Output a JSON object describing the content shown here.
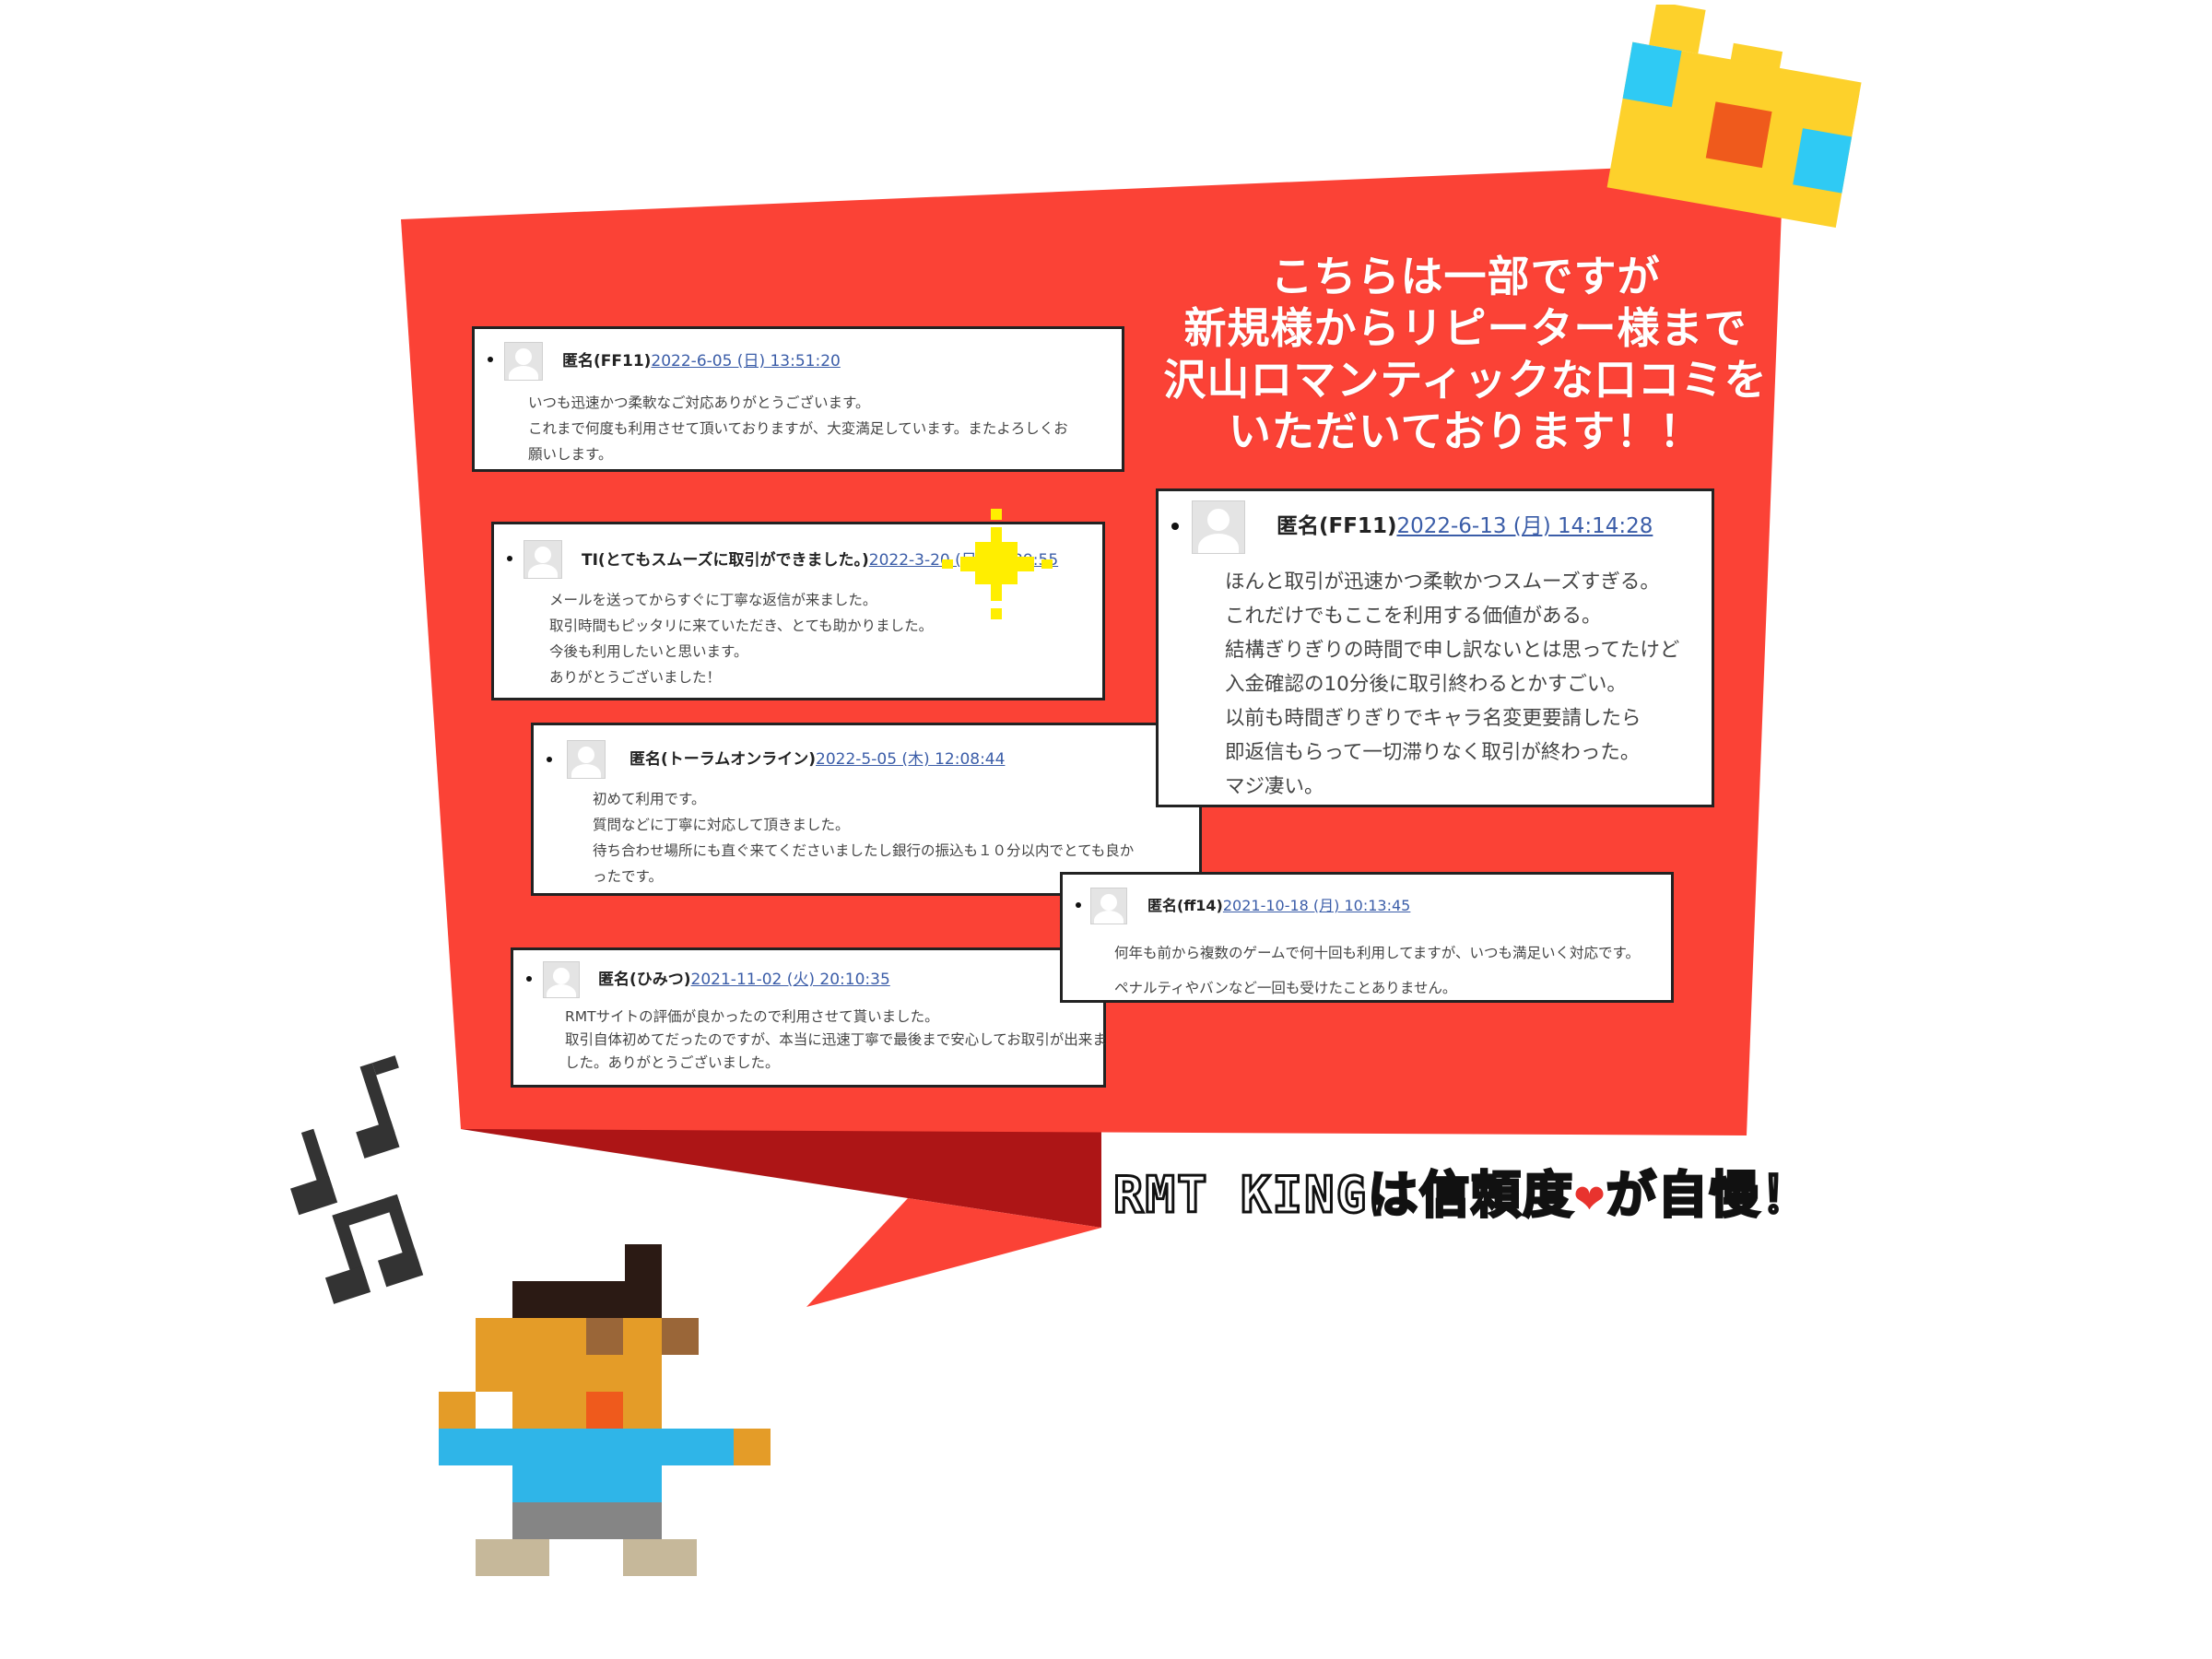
{
  "headline": {
    "lines": [
      "こちらは一部ですが",
      "新規様からリピーター様まで",
      "沢山ロマンティックな口コミを",
      "いただいております！！"
    ]
  },
  "reviews": [
    {
      "author": "匿名(FF11)",
      "date": "2022-6-05 (日) 13:51:20",
      "lines": [
        "いつも迅速かつ柔軟なご対応ありがとうございます。",
        "これまで何度も利用させて頂いておりますが、大変満足しています。またよろしくお",
        "願いします。"
      ]
    },
    {
      "author": "TI(とてもスムーズに取引ができました。)",
      "date": "2022-3-20 (日) 15:39:55",
      "lines": [
        "メールを送ってからすぐに丁寧な返信が来ました。",
        "取引時間もピッタリに来ていただき、とても助かりました。",
        "今後も利用したいと思います。",
        "ありがとうございました！"
      ]
    },
    {
      "author": "匿名(トーラムオンライン)",
      "date": "2022-5-05 (木) 12:08:44",
      "lines": [
        "初めて利用です。",
        "質問などに丁寧に対応して頂きました。",
        "待ち合わせ場所にも直ぐ来てくださいましたし銀行の振込も１０分以内でとても良か",
        "ったです。"
      ]
    },
    {
      "author": "匿名(ひみつ)",
      "date": "2021-11-02 (火) 20:10:35",
      "lines": [
        "RMTサイトの評価が良かったので利用させて貰いました。",
        "取引自体初めてだったのですが、本当に迅速丁寧で最後まで安心してお取引が出来ま",
        "した。ありがとうございました。"
      ]
    },
    {
      "author": "匿名(FF11)",
      "date": "2022-6-13 (月) 14:14:28",
      "lines": [
        "ほんと取引が迅速かつ柔軟かつスムーズすぎる。",
        "これだけでもここを利用する価値がある。",
        "結構ぎりぎりの時間で申し訳ないとは思ってたけど",
        "入金確認の10分後に取引終わるとかすごい。",
        "以前も時間ぎりぎりでキャラ名変更要請したら",
        "即返信もらって一切滞りなく取引が終わった。",
        "マジ凄い。"
      ]
    },
    {
      "author": "匿名(ff14)",
      "date": "2021-10-18 (月) 10:13:45",
      "lines": [
        "何年も前から複数のゲームで何十回も利用してますが、いつも満足いく対応です。",
        "ペナルティやバンなど一回も受けたことありません。"
      ]
    }
  ],
  "caption": {
    "before": "RMT KINGは信頼度",
    "heart": "❤",
    "after": "が自慢！"
  },
  "colors": {
    "bubble": "#fb4236",
    "bubble_tail_dark": "#ad1516",
    "crown": "#fdd12b",
    "crown_gem_blue": "#2fcaf4",
    "crown_gem_orange": "#ef5a1c",
    "heart": "#e8332e",
    "link": "#3b5da8"
  },
  "icons": [
    "crown-icon",
    "music-note-icon",
    "avatar-placeholder-icon",
    "sparkle-icon",
    "pixel-character"
  ]
}
